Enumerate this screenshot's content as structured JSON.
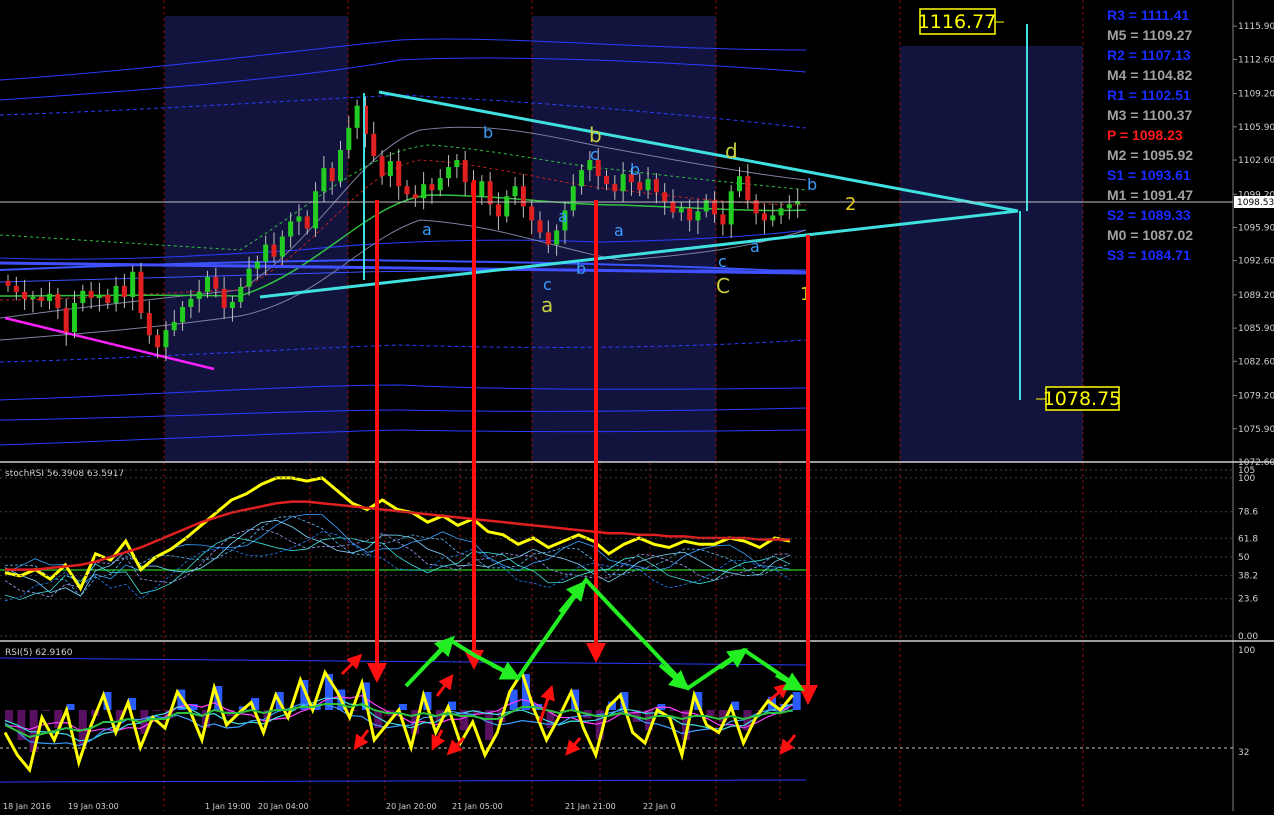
{
  "app": {
    "price_current": "1098.53",
    "box_high": "1116.77",
    "box_low": "1078.75"
  },
  "pivots": [
    {
      "label": "R3 = 1111.41",
      "color": "#1a2cff"
    },
    {
      "label": "M5 = 1109.27",
      "color": "#a0a0a0"
    },
    {
      "label": "R2 = 1107.13",
      "color": "#1a2cff"
    },
    {
      "label": "M4 = 1104.82",
      "color": "#a0a0a0"
    },
    {
      "label": "R1 = 1102.51",
      "color": "#1a2cff"
    },
    {
      "label": "M3 = 1100.37",
      "color": "#a0a0a0"
    },
    {
      "label": "P  = 1098.23",
      "color": "#ff1a1a"
    },
    {
      "label": "M2 = 1095.92",
      "color": "#a0a0a0"
    },
    {
      "label": "S1 = 1093.61",
      "color": "#1a2cff"
    },
    {
      "label": "M1 = 1091.47",
      "color": "#a0a0a0"
    },
    {
      "label": "S2 = 1089.33",
      "color": "#1a2cff"
    },
    {
      "label": "M0 = 1087.02",
      "color": "#a0a0a0"
    },
    {
      "label": "S3 = 1084.71",
      "color": "#1a2cff"
    }
  ],
  "wave_labels": {
    "main_a": "a",
    "main_c": "C",
    "main_1": "1",
    "main_2": "2",
    "sub_b1": "b",
    "sub_a1": "a",
    "sub_c1": "c",
    "sub_a2": "a",
    "sub_b2": "b",
    "sub_c2": "c",
    "sub_b3": "b",
    "sub_a3": "a",
    "sub_c3": "c",
    "sub_d": "d",
    "sub_a4": "a",
    "sub_b4": "b",
    "sub_b5": "b",
    "sub_d2": "d",
    "sub_c4": "c"
  },
  "panels": {
    "stoch_label": "stochRSI 56.3908 63.5917",
    "rsi_label": "RSI(5) 62.9160"
  },
  "x_axis": {
    "labels": [
      "18 Jan 2016",
      "19 Jan 03:00",
      "1 Jan 19:00",
      "20 Jan 04:00",
      "20 Jan 20:00",
      "21 Jan 05:00",
      "21 Jan 21:00",
      "22 Jan 0"
    ]
  },
  "colors": {
    "bull": "#22cc22",
    "bear": "#e02020",
    "triangle": "#40e0e0",
    "arrow_red": "#ff1010",
    "arrow_green": "#22ee22",
    "rsi_yellow": "#ffff00",
    "session_box": "#14164a"
  },
  "chart_data": [
    {
      "type": "candlestick",
      "title": "",
      "y_ticks": [
        1115.9,
        1112.6,
        1109.2,
        1105.9,
        1102.6,
        1099.2,
        1095.9,
        1092.6,
        1089.2,
        1085.9,
        1082.6,
        1079.2,
        1075.9,
        1072.6
      ],
      "ylim": [
        1072.6,
        1118.5
      ],
      "closes": [
        1090.1,
        1089.5,
        1088.8,
        1089.0,
        1088.6,
        1089.3,
        1087.9,
        1085.5,
        1088.4,
        1089.6,
        1088.9,
        1089.2,
        1088.4,
        1090.1,
        1089.0,
        1091.5,
        1087.4,
        1085.2,
        1084.0,
        1085.7,
        1086.5,
        1088.0,
        1088.8,
        1089.5,
        1091.0,
        1089.8,
        1087.9,
        1088.5,
        1090.0,
        1091.8,
        1092.5,
        1094.2,
        1093.0,
        1095.0,
        1096.5,
        1097.0,
        1095.8,
        1099.5,
        1101.8,
        1100.5,
        1103.6,
        1105.8,
        1108.0,
        1105.2,
        1103.0,
        1101.0,
        1102.5,
        1100.0,
        1099.2,
        1098.8,
        1100.2,
        1099.6,
        1100.8,
        1101.9,
        1102.6,
        1100.4,
        1099.0,
        1100.5,
        1098.2,
        1097.0,
        1099.0,
        1100.0,
        1098.0,
        1096.6,
        1095.4,
        1094.2,
        1095.6,
        1097.6,
        1100.0,
        1101.6,
        1102.6,
        1101.0,
        1100.2,
        1099.5,
        1101.2,
        1100.4,
        1099.6,
        1100.7,
        1099.4,
        1098.5,
        1097.4,
        1097.8,
        1096.6,
        1097.5,
        1098.6,
        1097.2,
        1096.2,
        1099.5,
        1101.0,
        1098.6,
        1097.3,
        1096.6,
        1097.1,
        1097.8,
        1098.2,
        1098.53
      ]
    },
    {
      "type": "line",
      "title": "stochRSI 56.3908 63.5917",
      "y_ticks": [
        105,
        100,
        78.6,
        61.8,
        50,
        38.2,
        23.6,
        0,
        0.0
      ],
      "ylim": [
        0,
        105
      ],
      "series": [
        {
          "values": [
            40,
            38,
            42,
            36,
            45,
            30,
            52,
            48,
            60,
            42,
            50,
            55,
            62,
            70,
            78,
            86,
            90,
            96,
            100,
            100,
            98,
            100,
            92,
            84,
            80,
            86,
            80,
            78,
            72,
            76,
            70,
            74,
            66,
            64,
            58,
            62,
            56,
            60,
            64,
            60,
            52,
            58,
            62,
            58,
            56,
            60,
            58,
            58,
            62,
            60,
            56,
            62,
            60
          ]
        },
        {
          "values": [
            42,
            42,
            42,
            43,
            44,
            45,
            47,
            50,
            53,
            56,
            60,
            64,
            68,
            72,
            75,
            78,
            80,
            82,
            84,
            85,
            85,
            84,
            83,
            82,
            81,
            80,
            79,
            78,
            77,
            76,
            75,
            74,
            73,
            72,
            71,
            70,
            69,
            68,
            67,
            66,
            65,
            65,
            64,
            64,
            63,
            63,
            62,
            62,
            62,
            62,
            61,
            61,
            61
          ]
        }
      ]
    },
    {
      "type": "line",
      "title": "RSI(5) 62.9160",
      "y_ticks": [
        100,
        32
      ],
      "ylim": [
        0,
        100
      ],
      "series": [
        {
          "values": [
            45,
            30,
            20,
            55,
            40,
            60,
            25,
            50,
            70,
            45,
            65,
            35,
            55,
            48,
            72,
            60,
            40,
            75,
            50,
            58,
            65,
            45,
            70,
            55,
            80,
            60,
            85,
            72,
            55,
            78,
            40,
            50,
            60,
            35,
            70,
            45,
            62,
            38,
            52,
            30,
            45,
            72,
            85,
            60,
            40,
            55,
            72,
            48,
            30,
            62,
            70,
            45,
            38,
            60,
            55,
            30,
            70,
            50,
            45,
            62,
            38,
            55,
            66,
            60,
            70
          ]
        },
        {
          "values": [
            50,
            46,
            42,
            44,
            46,
            48,
            46,
            48,
            52,
            52,
            54,
            52,
            54,
            54,
            58,
            58,
            56,
            60,
            58,
            58,
            60,
            58,
            60,
            60,
            62,
            62,
            64,
            64,
            62,
            64,
            60,
            58,
            58,
            56,
            58,
            56,
            58,
            56,
            56,
            54,
            54,
            58,
            62,
            62,
            60,
            58,
            60,
            58,
            56,
            56,
            58,
            56,
            54,
            56,
            56,
            54,
            56,
            56,
            54,
            56,
            54,
            56,
            58,
            58,
            60
          ]
        }
      ]
    }
  ]
}
